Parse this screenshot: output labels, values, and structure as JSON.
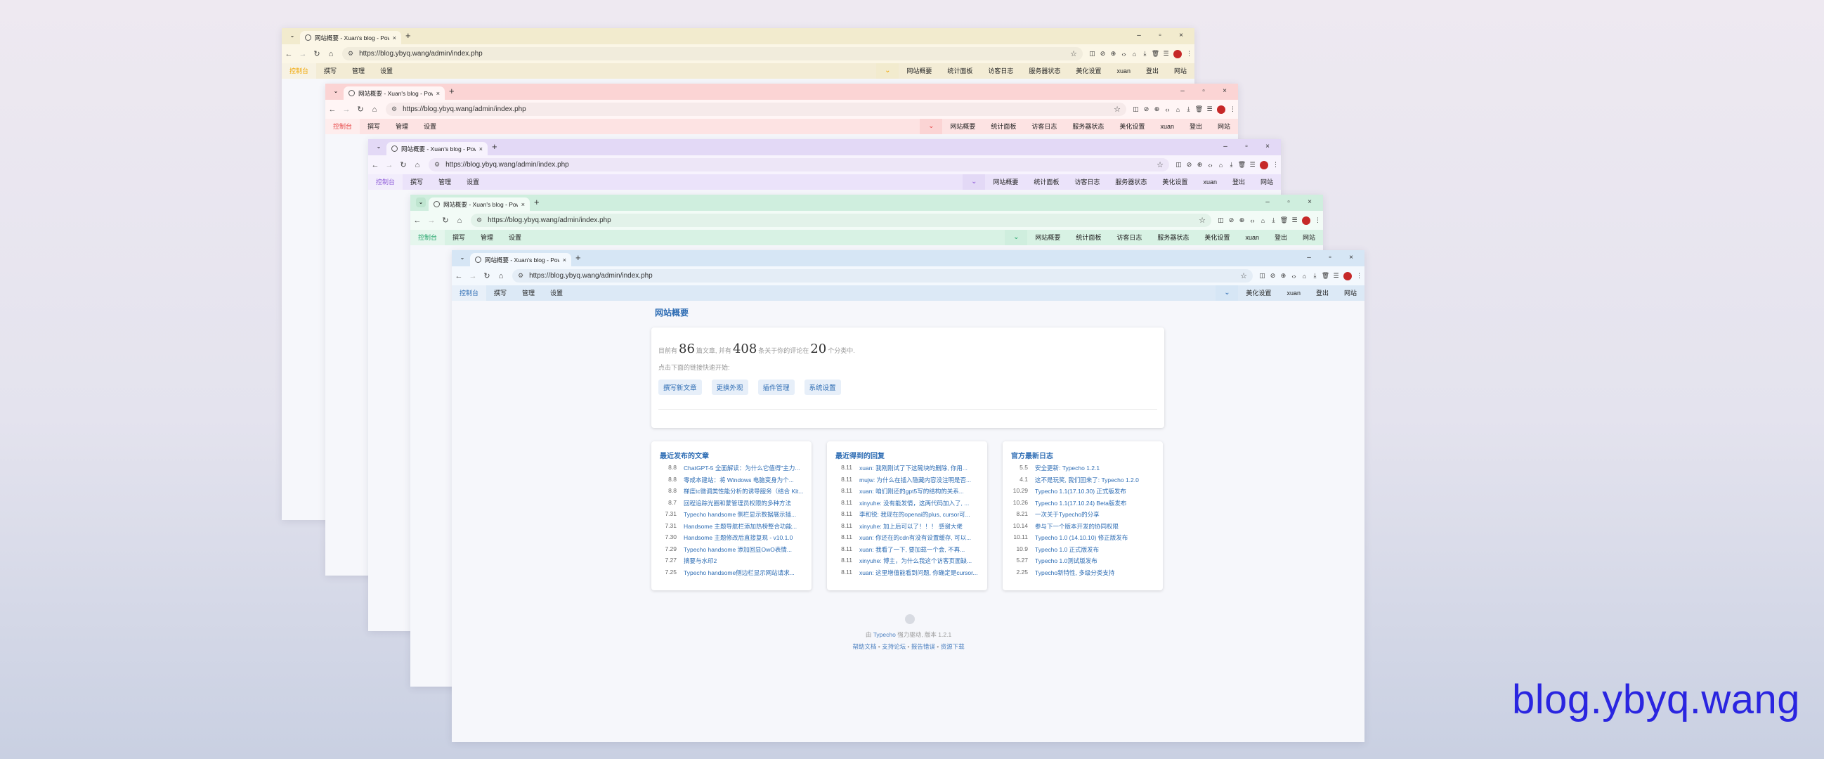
{
  "tab": {
    "title": "网站概要 - Xuan's blog - Pow",
    "close": "×",
    "new_tab": "+",
    "menu": "⌄"
  },
  "window_controls": {
    "minimize": "–",
    "maximize": "▫",
    "close": "×"
  },
  "addressbar": {
    "back": "←",
    "forward": "→",
    "reload": "↻",
    "home": "⌂",
    "tune": "⚙",
    "url": "https://blog.ybyq.wang/admin/index.php",
    "bookmark_star": "☆"
  },
  "extensions": [
    "◫",
    "⊘",
    "⊕",
    "‹›",
    "⌂",
    "⤓",
    "🗑",
    "☰"
  ],
  "typecho_nav": {
    "left": [
      "控制台",
      "撰写",
      "管理",
      "设置"
    ],
    "alert_icon": "⌄",
    "right_full": [
      "网站概要",
      "统计面板",
      "访客日志",
      "服务器状态",
      "美化设置",
      "xuan",
      "登出",
      "网站"
    ],
    "right_front": [
      "美化设置",
      "xuan",
      "登出",
      "网站"
    ]
  },
  "windows": [
    {
      "theme": "yellow",
      "bar": "#f2ebce",
      "addr": "#fbf6e6",
      "nav": "#f3ecd5",
      "active": "#f0a500",
      "tab": "#fbf6e6",
      "urlfill": "#f1ecdc"
    },
    {
      "theme": "pink",
      "bar": "#fbd4d4",
      "addr": "#fff5f5",
      "nav": "#fde3e3",
      "active": "#e64545",
      "tab": "#fff5f5",
      "urlfill": "#f6eaea"
    },
    {
      "theme": "purple",
      "bar": "#e3d9f6",
      "addr": "#f7f3fd",
      "nav": "#ebe3fa",
      "active": "#8e5ad9",
      "tab": "#f7f3fd",
      "urlfill": "#ede6f7"
    },
    {
      "theme": "green",
      "bar": "#cfeede",
      "addr": "#f2fbf6",
      "nav": "#d8f2e4",
      "active": "#22a46a",
      "tab": "#f2fbf6",
      "urlfill": "#e2f2e9"
    },
    {
      "theme": "blue",
      "bar": "#d6e6f5",
      "addr": "#f3f8fd",
      "nav": "#dce9f6",
      "active": "#2e6db4",
      "tab": "#f3f8fd",
      "urlfill": "#e4edf6"
    }
  ],
  "overview": {
    "title": "网站概要",
    "stats_pre": "目前有",
    "posts": "86",
    "stats_mid1": "篇文章, 并有",
    "comments": "408",
    "stats_mid2": "条关于你的评论在",
    "categories": "20",
    "stats_post": "个分类中.",
    "hint": "点击下面的链接快速开始:",
    "quick_links": [
      "撰写新文章",
      "更换外观",
      "插件管理",
      "系统设置"
    ]
  },
  "recent_posts": {
    "title": "最近发布的文章",
    "items": [
      {
        "date": "8.8",
        "text": "ChatGPT-5 全面解读：为什么它值得\"主力..."
      },
      {
        "date": "8.8",
        "text": "零成本建站：将 Windows 电脑变身为个..."
      },
      {
        "date": "8.8",
        "text": "梯度tc微调类性能分析的诱导服务（结合 Kit..."
      },
      {
        "date": "8.7",
        "text": "回程追踪光圈和蒙管理员权限的多种方法"
      },
      {
        "date": "7.31",
        "text": "Typecho handsome 侧栏显示数据展示插..."
      },
      {
        "date": "7.31",
        "text": "Handsome 主题导航栏添加热榜整合功能..."
      },
      {
        "date": "7.30",
        "text": "Handsome 主题修改后直接复现 - v10.1.0"
      },
      {
        "date": "7.29",
        "text": "Typecho handsome 添加回显OwO表情..."
      },
      {
        "date": "7.27",
        "text": "摘要与水印2"
      },
      {
        "date": "7.25",
        "text": "Typecho handsome侧边栏显示网站请求..."
      }
    ]
  },
  "recent_comments": {
    "title": "最近得到的回复",
    "items": [
      {
        "date": "8.11",
        "text": "xuan: 我刚刚试了下这碗块的删除, 你用..."
      },
      {
        "date": "8.11",
        "text": "mujw: 为什么在插入隐藏内容没注明是否..."
      },
      {
        "date": "8.11",
        "text": "xuan: 咱们刚还的gpt5写的结构的关系..."
      },
      {
        "date": "8.11",
        "text": "xinyuhe: 没有能发情，这两代码加入了, ..."
      },
      {
        "date": "8.11",
        "text": "李和锐: 我现在的openai的plus, cursor可..."
      },
      {
        "date": "8.11",
        "text": "xinyuhe: 加上后可以了！！！ 感谢大佬"
      },
      {
        "date": "8.11",
        "text": "xuan: 你还在的cdn有没有设置缓存, 可以..."
      },
      {
        "date": "8.11",
        "text": "xuan: 我看了一下, 要加载一个会, 不再..."
      },
      {
        "date": "8.11",
        "text": "xinyuhe: 博主，为什么我这个访客页面缺..."
      },
      {
        "date": "8.11",
        "text": "xuan: 这里增值能看到问题, 你确定是cursor..."
      }
    ]
  },
  "official_news": {
    "title": "官方最新日志",
    "items": [
      {
        "date": "5.5",
        "text": "安全更新: Typecho 1.2.1"
      },
      {
        "date": "4.1",
        "text": "这不是玩笑, 我们回来了: Typecho 1.2.0"
      },
      {
        "date": "10.29",
        "text": "Typecho 1.1(17.10.30) 正式版发布"
      },
      {
        "date": "10.26",
        "text": "Typecho 1.1(17.10.24) Beta版发布"
      },
      {
        "date": "8.21",
        "text": "一次关于Typecho的分享"
      },
      {
        "date": "10.14",
        "text": "参与下一个版本开发的协同权限"
      },
      {
        "date": "10.11",
        "text": "Typecho 1.0 (14.10.10) 修正版发布"
      },
      {
        "date": "10.9",
        "text": "Typecho 1.0 正式版发布"
      },
      {
        "date": "5.27",
        "text": "Typecho 1.0测试版发布"
      },
      {
        "date": "2.25",
        "text": "Typecho新特性, 多级分类支持"
      }
    ]
  },
  "footer": {
    "line1_pre": "由",
    "typecho": "Typecho",
    "line1_post": "强力驱动, 版本 1.2.1",
    "links": [
      "帮助文档",
      "支持论坛",
      "报告错误",
      "资源下载"
    ],
    "sep": " • "
  },
  "watermark": "blog.ybyq.wang"
}
